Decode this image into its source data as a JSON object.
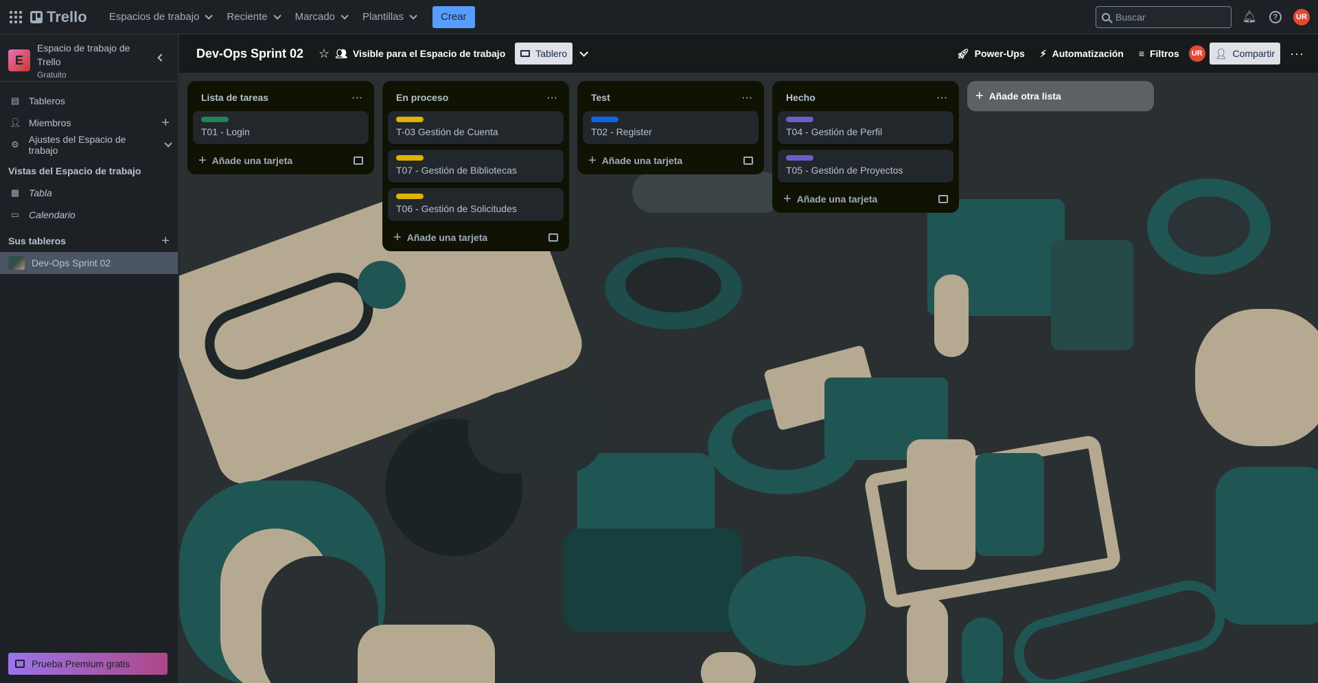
{
  "topnav": {
    "logo": "Trello",
    "menus": [
      "Espacios de trabajo",
      "Reciente",
      "Marcado",
      "Plantillas"
    ],
    "create_label": "Crear",
    "search_placeholder": "Buscar",
    "avatar_initials": "UR"
  },
  "sidebar": {
    "workspace_name": "Espacio de trabajo de Trello",
    "workspace_initial": "E",
    "workspace_plan": "Gratuito",
    "items": [
      {
        "label": "Tableros",
        "icon": "board-icon"
      },
      {
        "label": "Miembros",
        "icon": "person-icon"
      },
      {
        "label": "Ajustes del Espacio de trabajo",
        "icon": "gear-icon"
      }
    ],
    "views_heading": "Vistas del Espacio de trabajo",
    "views": [
      {
        "label": "Tabla",
        "icon": "table-icon"
      },
      {
        "label": "Calendario",
        "icon": "calendar-icon"
      }
    ],
    "boards_heading": "Sus tableros",
    "boards": [
      {
        "label": "Dev-Ops Sprint 02"
      }
    ],
    "premium_label": "Prueba Premium gratis"
  },
  "board": {
    "title": "Dev-Ops Sprint 02",
    "visibility": "Visible para el Espacio de trabajo",
    "view_label": "Tablero",
    "powerups": "Power-Ups",
    "automation": "Automatización",
    "filters": "Filtros",
    "share": "Compartir",
    "avatar_initials": "UR",
    "add_list": "Añade otra lista",
    "add_card": "Añade una tarjeta",
    "lists": [
      {
        "title": "Lista de tareas",
        "cards": [
          {
            "title": "T01 - Login",
            "label_color": "#1f845a"
          }
        ]
      },
      {
        "title": "En proceso",
        "cards": [
          {
            "title": "T-03 Gestión de Cuenta",
            "label_color": "#e2b203"
          },
          {
            "title": "T07 - Gestión de Bibliotecas",
            "label_color": "#e2b203"
          },
          {
            "title": "T06 - Gestión de Solicitudes",
            "label_color": "#e2b203"
          }
        ]
      },
      {
        "title": "Test",
        "cards": [
          {
            "title": "T02 - Register",
            "label_color": "#0c66e4"
          }
        ]
      },
      {
        "title": "Hecho",
        "cards": [
          {
            "title": "T04 - Gestión de Perfil",
            "label_color": "#6e5dc6"
          },
          {
            "title": "T05 - Gestión de Proyectos",
            "label_color": "#6e5dc6"
          }
        ]
      }
    ]
  }
}
